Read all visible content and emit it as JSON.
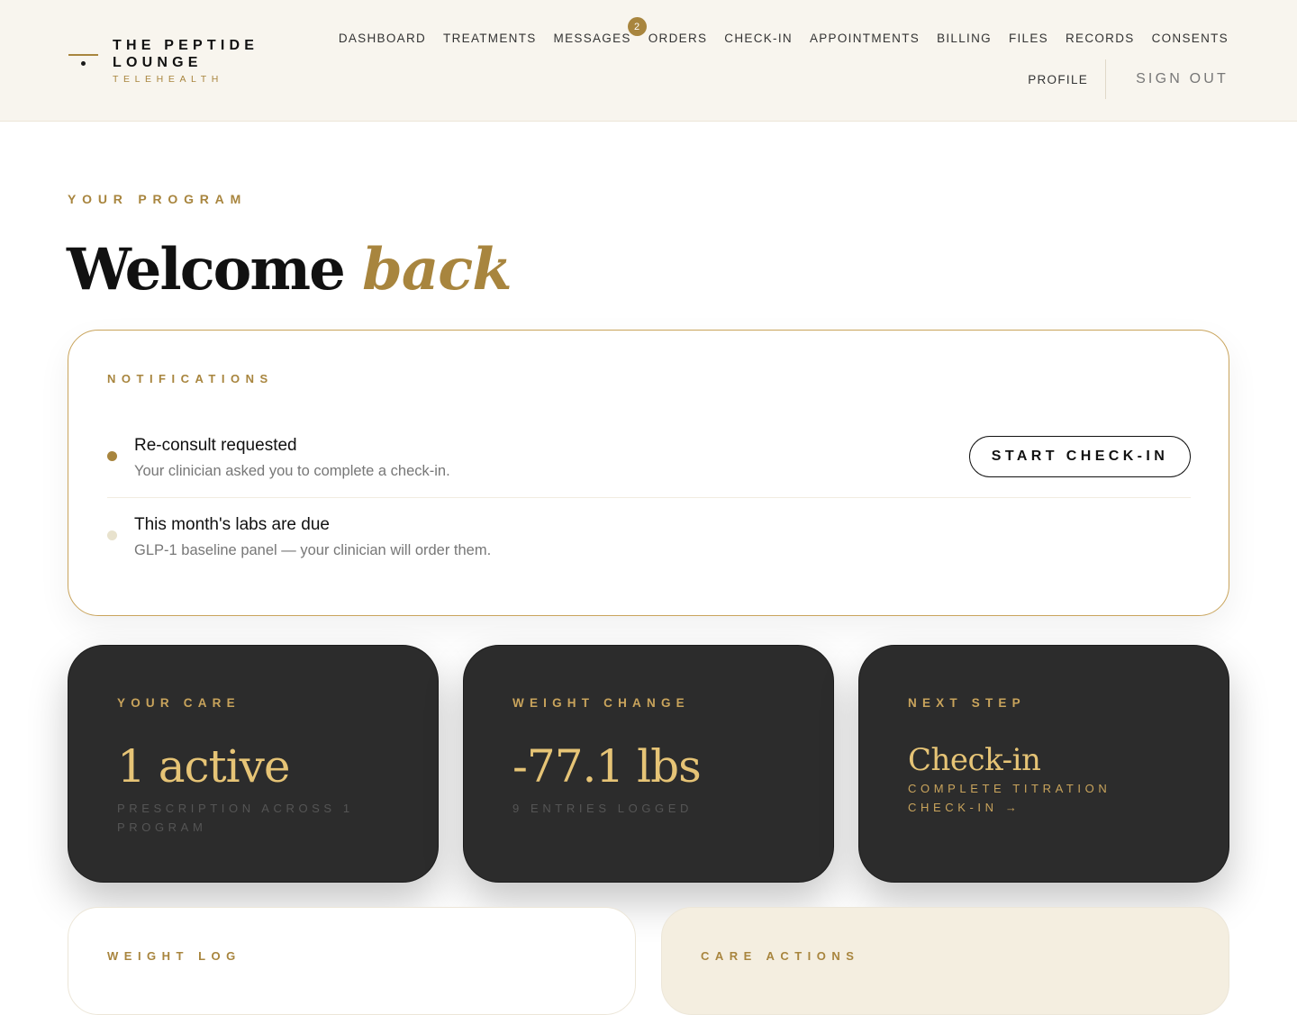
{
  "brand": {
    "line1": "THE PEPTIDE",
    "line2": "LOUNGE",
    "sub": "TELEHEALTH",
    "accent_color": "#a8853e",
    "logo_icon": "horizon-dot-mark"
  },
  "nav": {
    "items": [
      {
        "label": "DASHBOARD"
      },
      {
        "label": "TREATMENTS"
      },
      {
        "label": "MESSAGES",
        "badge": "2"
      },
      {
        "label": "ORDERS"
      },
      {
        "label": "CHECK-IN"
      },
      {
        "label": "APPOINTMENTS"
      },
      {
        "label": "BILLING"
      },
      {
        "label": "FILES"
      },
      {
        "label": "RECORDS"
      },
      {
        "label": "CONSENTS"
      }
    ],
    "profile": "PROFILE",
    "signout": "SIGN OUT"
  },
  "hero": {
    "eyebrow": "YOUR PROGRAM",
    "title": "Welcome",
    "title_accent": "back"
  },
  "notifications": {
    "title": "NOTIFICATIONS",
    "items": [
      {
        "title": "Re-consult requested",
        "body": "Your clinician asked you to complete a check-in.",
        "action": "START CHECK-IN",
        "status": "active"
      },
      {
        "title": "This month's labs are due",
        "body": "GLP-1 baseline panel — your clinician will order them.",
        "status": "muted"
      }
    ]
  },
  "stats": [
    {
      "label": "YOUR CARE",
      "value": "1 active",
      "sub": "PRESCRIPTION ACROSS 1 PROGRAM"
    },
    {
      "label": "WEIGHT CHANGE",
      "value": "-77.1 lbs",
      "sub": "9 ENTRIES LOGGED"
    },
    {
      "label": "NEXT STEP",
      "value": "Check-in",
      "sub": "COMPLETE TITRATION CHECK-IN →"
    }
  ],
  "sections": {
    "weight_log": "WEIGHT LOG",
    "care_actions": "CARE ACTIONS"
  },
  "colors": {
    "gold": "#a8853e",
    "gold_light": "#e6c476",
    "dark_card": "#2c2c2c",
    "header_bg": "#f8f5ee"
  }
}
